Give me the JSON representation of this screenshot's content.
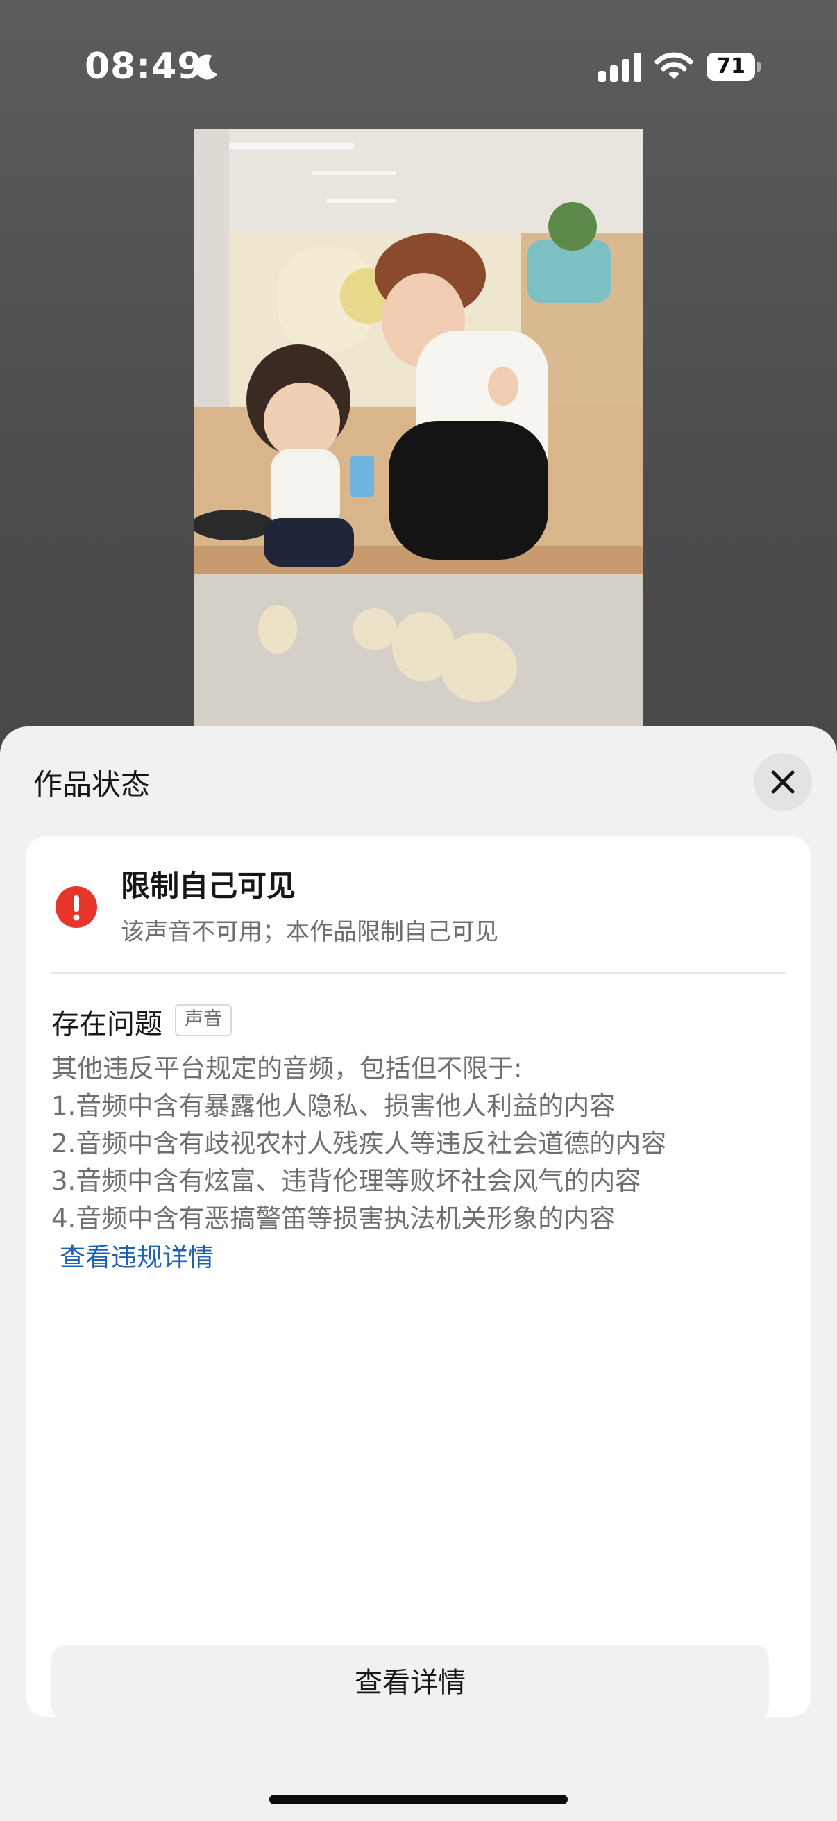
{
  "status_bar": {
    "time": "08:49",
    "battery_level": "71",
    "icons": [
      "moon-icon",
      "signal-icon",
      "wifi-icon",
      "battery-icon"
    ]
  },
  "photo": {
    "subject": "photo-of-woman-and-child-sitting"
  },
  "sheet": {
    "title": "作品状态",
    "close_icon": "close-icon",
    "status": {
      "icon": "alert-icon",
      "icon_color": "#e8352b",
      "title": "限制自己可见",
      "description": "该声音不可用；本作品限制自己可见"
    },
    "issue": {
      "label": "存在问题",
      "tag": "声音",
      "lines": [
        "其他违反平台规定的音频，包括但不限于:",
        "1.音频中含有暴露他人隐私、损害他人利益的内容",
        "2.音频中含有歧视农村人残疾人等违反社会道德的内容",
        "3.音频中含有炫富、违背伦理等败坏社会风气的内容",
        "4.音频中含有恶搞警笛等损害执法机关形象的内容"
      ],
      "link": "查看违规详情",
      "link_color": "#1f62b3"
    },
    "details_button": "查看详情"
  }
}
